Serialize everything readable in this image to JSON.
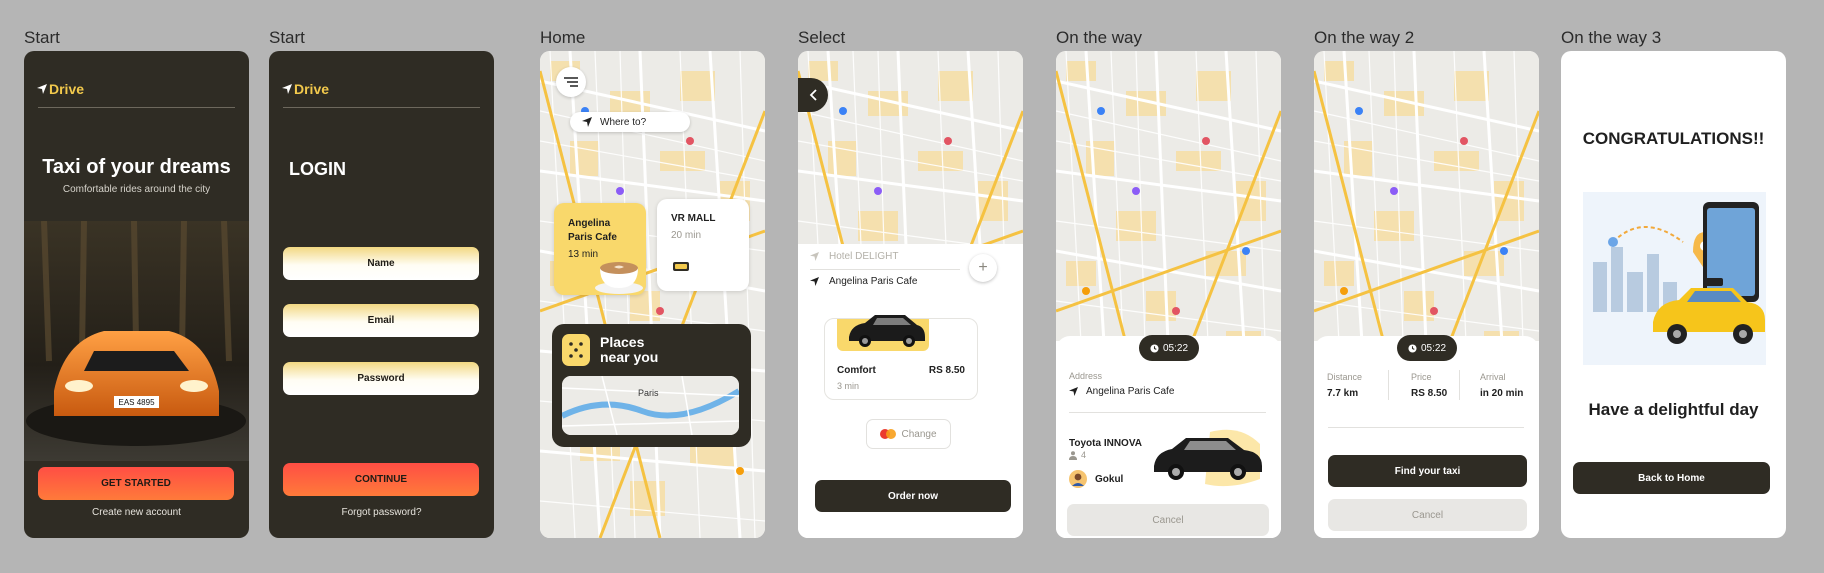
{
  "screens": [
    {
      "label": "Start",
      "brand": "Drive",
      "title": "Taxi of your dreams",
      "subtitle": "Comfortable rides around the city",
      "plate": "EAS 4895",
      "primary_btn": "GET STARTED",
      "link": "Create new account"
    },
    {
      "label": "Start",
      "brand": "Drive",
      "title": "LOGIN",
      "fields": [
        "Name",
        "Email",
        "Password"
      ],
      "primary_btn": "CONTINUE",
      "link": "Forgot password?"
    },
    {
      "label": "Home",
      "search_placeholder": "Where to?",
      "card1": {
        "name_line1": "Angelina",
        "name_line2": "Paris Cafe",
        "time": "13 min"
      },
      "card2": {
        "name": "VR MALL",
        "time": "20 min"
      },
      "places_line1": "Places",
      "places_line2": "near you",
      "mini_map_label": "Paris"
    },
    {
      "label": "Select",
      "from": "Hotel DELIGHT",
      "to": "Angelina Paris Cafe",
      "car": {
        "name": "Comfort",
        "price": "RS 8.50",
        "time": "3 min"
      },
      "change": "Change",
      "order_btn": "Order now"
    },
    {
      "label": "On the way",
      "eta": "05:22",
      "address_label": "Address",
      "address": "Angelina Paris Cafe",
      "car_name": "Toyota INNOVA",
      "seats": "4",
      "driver": "Gokul",
      "cancel": "Cancel"
    },
    {
      "label": "On the way 2",
      "eta": "05:22",
      "stats": [
        {
          "label": "Distance",
          "value": "7.7 km"
        },
        {
          "label": "Price",
          "value": "RS 8.50"
        },
        {
          "label": "Arrival",
          "value": "in 20 min"
        }
      ],
      "primary_btn": "Find your taxi",
      "cancel": "Cancel"
    },
    {
      "label": "On the way 3",
      "title": "CONGRATULATIONS!!",
      "message": "Have a delightful day",
      "primary_btn": "Back to Home"
    }
  ],
  "colors": {
    "dark": "#2f2c24",
    "accent_yellow": "#f2c94c",
    "red": "#ff4e44",
    "canvas": "#b5b5b5"
  }
}
